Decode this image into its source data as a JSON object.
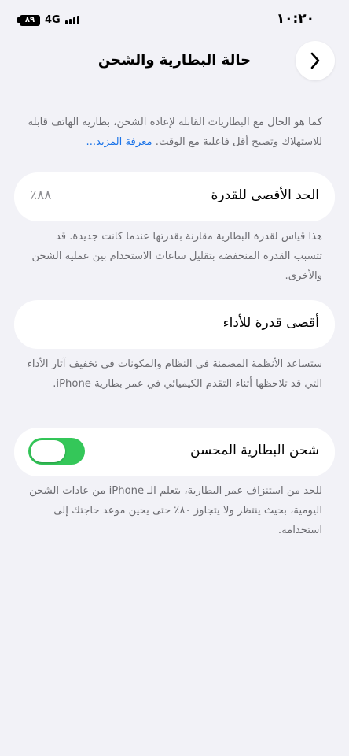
{
  "status_bar": {
    "time": "١٠:٢٠",
    "network": "4G",
    "battery": "٨٩"
  },
  "nav": {
    "title": "حالة البطارية والشحن",
    "back_icon": "chevron-right-icon"
  },
  "intro": {
    "text": "كما هو الحال مع البطاريات القابلة لإعادة الشحن، بطارية الهاتف قابلة للاستهلاك وتصبح أقل فاعلية مع الوقت.",
    "link": "معرفة المزيد..."
  },
  "max_capacity": {
    "label": "الحد الأقصى للقدرة",
    "value": "٨٨٪",
    "description": "هذا قياس لقدرة البطارية مقارنة بقدرتها عندما كانت جديدة. قد تتسبب القدرة المنخفضة بتقليل ساعات الاستخدام بين عملية الشحن والأخرى."
  },
  "peak_performance": {
    "label": "أقصى قدرة للأداء",
    "description": "ستساعد الأنظمة المضمنة في النظام والمكونات في تخفيف آثار الأداء التي قد تلاحظها أثناء التقدم الكيميائي في عمر بطارية iPhone."
  },
  "optimized_charging": {
    "label": "شحن البطارية المحسن",
    "enabled": true,
    "description": "للحد من استنزاف عمر البطارية، يتعلم الـ iPhone من عادات الشحن اليومية، بحيث ينتظر ولا يتجاوز ٨٠٪ حتى يحين موعد حاجتك إلى استخدامه."
  },
  "colors": {
    "accent": "#34c759",
    "link": "#1a73e8",
    "background": "#f2f2f7"
  }
}
